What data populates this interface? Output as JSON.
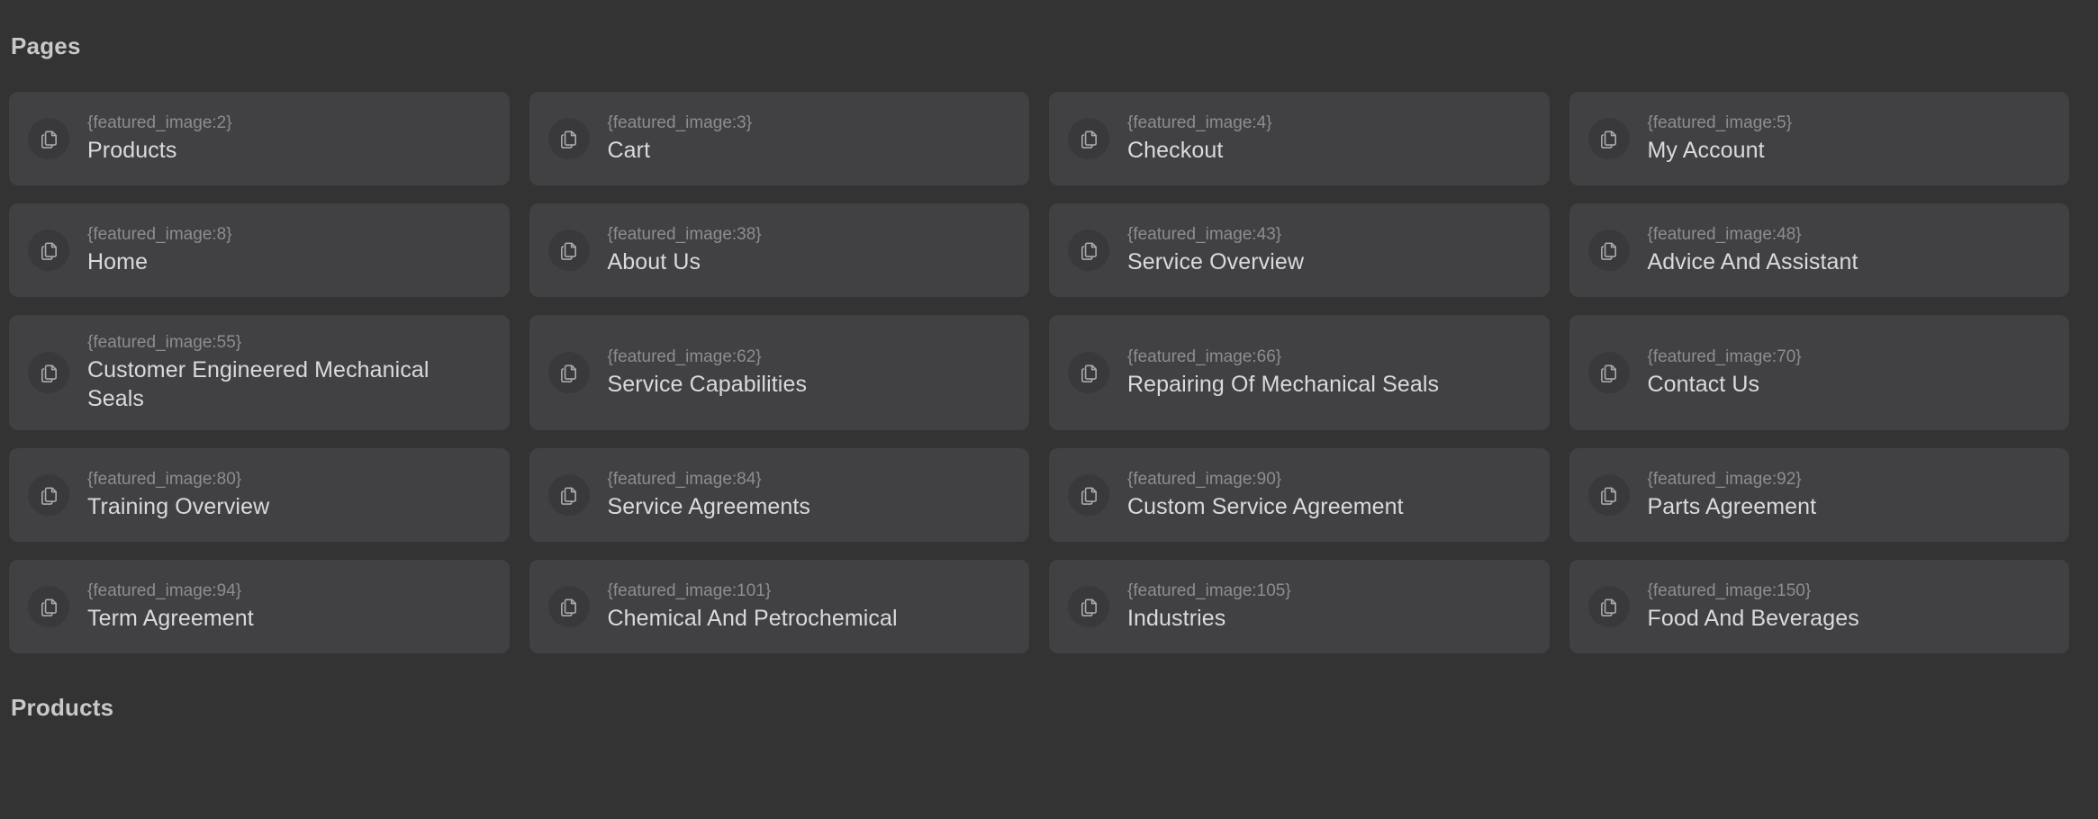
{
  "sections": [
    {
      "heading": "Pages",
      "rows": [
        [
          {
            "slug": "{featured_image:2}",
            "title": "Products",
            "icon": "copy-icon"
          },
          {
            "slug": "{featured_image:3}",
            "title": "Cart",
            "icon": "copy-icon"
          },
          {
            "slug": "{featured_image:4}",
            "title": "Checkout",
            "icon": "copy-icon"
          },
          {
            "slug": "{featured_image:5}",
            "title": "My Account",
            "icon": "copy-icon"
          }
        ],
        [
          {
            "slug": "{featured_image:8}",
            "title": "Home",
            "icon": "copy-icon"
          },
          {
            "slug": "{featured_image:38}",
            "title": "About Us",
            "icon": "copy-icon"
          },
          {
            "slug": "{featured_image:43}",
            "title": "Service Overview",
            "icon": "copy-icon"
          },
          {
            "slug": "{featured_image:48}",
            "title": "Advice And Assistant",
            "icon": "copy-icon"
          }
        ],
        [
          {
            "slug": "{featured_image:55}",
            "title": "Customer Engineered Mechanical Seals",
            "icon": "copy-icon"
          },
          {
            "slug": "{featured_image:62}",
            "title": "Service Capabilities",
            "icon": "copy-icon"
          },
          {
            "slug": "{featured_image:66}",
            "title": "Repairing Of Mechanical Seals",
            "icon": "copy-icon"
          },
          {
            "slug": "{featured_image:70}",
            "title": "Contact Us",
            "icon": "copy-icon"
          }
        ],
        [
          {
            "slug": "{featured_image:80}",
            "title": "Training Overview",
            "icon": "copy-icon"
          },
          {
            "slug": "{featured_image:84}",
            "title": "Service Agreements",
            "icon": "copy-icon"
          },
          {
            "slug": "{featured_image:90}",
            "title": "Custom Service Agreement",
            "icon": "copy-icon"
          },
          {
            "slug": "{featured_image:92}",
            "title": "Parts Agreement",
            "icon": "copy-icon"
          }
        ],
        [
          {
            "slug": "{featured_image:94}",
            "title": "Term Agreement",
            "icon": "copy-icon"
          },
          {
            "slug": "{featured_image:101}",
            "title": "Chemical And Petrochemical",
            "icon": "copy-icon"
          },
          {
            "slug": "{featured_image:105}",
            "title": "Industries",
            "icon": "copy-icon"
          },
          {
            "slug": "{featured_image:150}",
            "title": "Food And Beverages",
            "icon": "copy-icon"
          }
        ]
      ]
    },
    {
      "heading": "Products",
      "rows": []
    }
  ],
  "colors": {
    "page_background": "#333334",
    "card_background": "#414143",
    "icon_circle_background": "#39393b",
    "heading_text": "#c9c9cb",
    "slug_text": "#8d8d90",
    "title_text": "#dadadc"
  }
}
